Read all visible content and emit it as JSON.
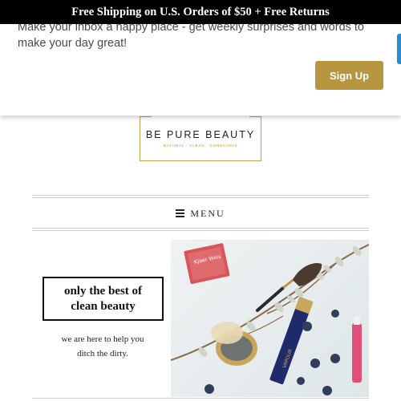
{
  "banner": {
    "text": "Free Shipping on U.S. Orders of $50 + Free Returns"
  },
  "signup": {
    "message": "Make your inbox a happy place - get weekly surprises and words to make your day great!",
    "button_label": "Sign Up"
  },
  "logo": {
    "name": "BE PURE BEAUTY",
    "tagline": "NATURAL · CLEAN · CONSCIOUS"
  },
  "menu": {
    "icon": "bars-icon",
    "label": "MENU"
  },
  "hero": {
    "line1": "only the best of",
    "line2": "clean beauty",
    "sub1": "we are here to help you",
    "sub2": "ditch the dirty.",
    "product_label": "Kjaer Weis",
    "lipstick_label": "VAPOUR"
  },
  "colors": {
    "banner_bg": "#000000",
    "accent_gold": "#b8963f",
    "side_tab_blue": "#2b8bd1"
  }
}
